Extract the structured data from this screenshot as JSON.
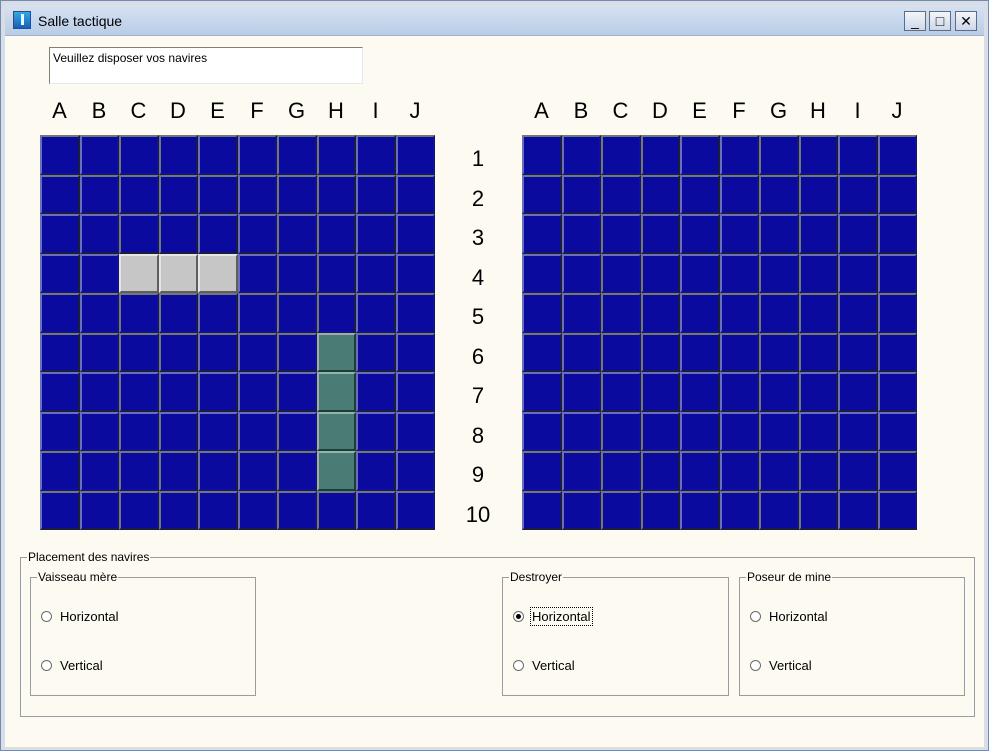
{
  "window": {
    "title": "Salle tactique",
    "minimize": "_",
    "maximize": "□",
    "close": "✕"
  },
  "status_text": "Veuillez disposer vos navires",
  "columns": [
    "A",
    "B",
    "C",
    "D",
    "E",
    "F",
    "G",
    "H",
    "I",
    "J"
  ],
  "rows": [
    "1",
    "2",
    "3",
    "4",
    "5",
    "6",
    "7",
    "8",
    "9",
    "10"
  ],
  "player_grid": {
    "ships": [
      {
        "cells": [
          [
            "C",
            4
          ],
          [
            "D",
            4
          ],
          [
            "E",
            4
          ]
        ],
        "color": "#c6c6c6"
      },
      {
        "cells": [
          [
            "H",
            6
          ],
          [
            "H",
            7
          ],
          [
            "H",
            8
          ],
          [
            "H",
            9
          ]
        ],
        "color": "#4a7b74"
      }
    ]
  },
  "placement": {
    "title": "Placement des navires",
    "groups": [
      {
        "title": "Vaisseau mère",
        "horizontal": "Horizontal",
        "vertical": "Vertical",
        "selected": "none"
      },
      {
        "title": "Destroyer",
        "horizontal": "Horizontal",
        "vertical": "Vertical",
        "selected": "horizontal"
      },
      {
        "title": "Poseur de mine",
        "horizontal": "Horizontal",
        "vertical": "Vertical",
        "selected": "none"
      }
    ]
  },
  "colors": {
    "water": "#0a0a9e",
    "background": "#fdfbf1"
  }
}
